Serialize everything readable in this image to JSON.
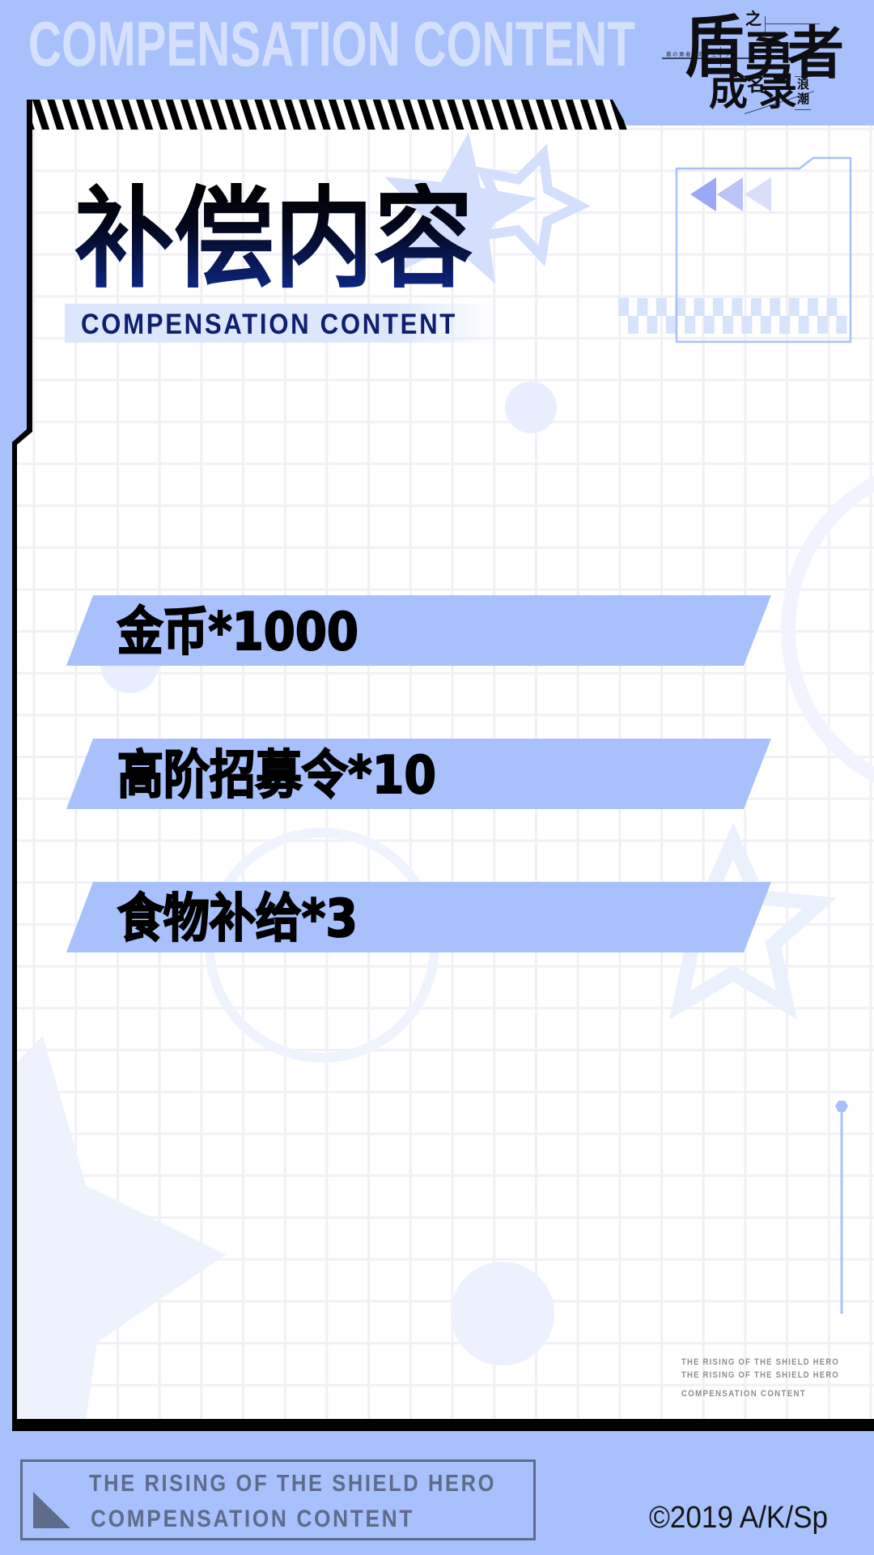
{
  "banner": {
    "text": "COMPENSATION CONTENT"
  },
  "logo": {
    "dun": "盾",
    "zhi": "之",
    "yong": "勇",
    "zhe": "者",
    "cheng": "成",
    "ming": "名",
    "lu": "录",
    "sub": [
      "浪",
      "潮"
    ],
    "kana_line": "盾の勇者の成り上がり"
  },
  "title": {
    "zh": "补偿内容",
    "en": "COMPENSATION CONTENT"
  },
  "rewards": [
    {
      "label": "金币*1000",
      "item": "金币",
      "quantity": 1000
    },
    {
      "label": "高阶招募令*10",
      "item": "高阶招募令",
      "quantity": 10
    },
    {
      "label": "食物补给*3",
      "item": "食物补给",
      "quantity": 3
    }
  ],
  "side_caption": {
    "lines": [
      "THE RISING OF THE SHIELD HERO",
      "THE RISING OF THE SHIELD HERO",
      "COMPENSATION CONTENT"
    ]
  },
  "footer": {
    "line1": "THE RISING OF THE SHIELD HERO",
    "line2": "COMPENSATION CONTENT",
    "copyright": "©2019 A/K/Sp"
  },
  "icons": {
    "rewind": "triple-triangle-left-icon",
    "stars": "star-icon",
    "pin": "hexagon-pin-icon",
    "corner": "corner-triangle-icon"
  },
  "colors": {
    "background": "#a8c1fc",
    "reward_band": "#a8c1fc",
    "banner_text": "#d5e0fd",
    "title_gradient_top": "#000000",
    "title_gradient_bottom": "#0e2a8e",
    "subtitle_text": "#0d1f6e",
    "subtitle_band": "#dce6fc",
    "frame_border": "#000000",
    "footer_text": "#5f6b8a",
    "caption_text": "#8c8c92",
    "rewind_triangles": [
      "#9ba8f5",
      "#bbc3f8",
      "#dbdefa"
    ]
  }
}
